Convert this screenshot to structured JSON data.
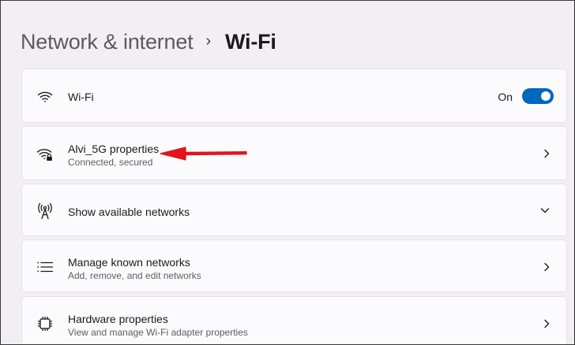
{
  "breadcrumb": {
    "parent": "Network & internet",
    "separator": "›",
    "current": "Wi-Fi"
  },
  "cards": {
    "wifi": {
      "title": "Wi-Fi",
      "toggle_label": "On",
      "toggle_state": true,
      "icon": "wifi-icon"
    },
    "properties": {
      "title": "Alvi_5G properties",
      "subtitle": "Connected, secured",
      "icon": "wifi-secured-icon"
    },
    "available": {
      "title": "Show available networks",
      "icon": "antenna-icon"
    },
    "known": {
      "title": "Manage known networks",
      "subtitle": "Add, remove, and edit networks",
      "icon": "list-icon"
    },
    "hardware": {
      "title": "Hardware properties",
      "subtitle": "View and manage Wi-Fi adapter properties",
      "icon": "chip-icon"
    }
  },
  "colors": {
    "accent": "#0067c0",
    "annotation_arrow": "#e4121b",
    "background": "#f1eff4",
    "card": "#fbfbfd"
  }
}
